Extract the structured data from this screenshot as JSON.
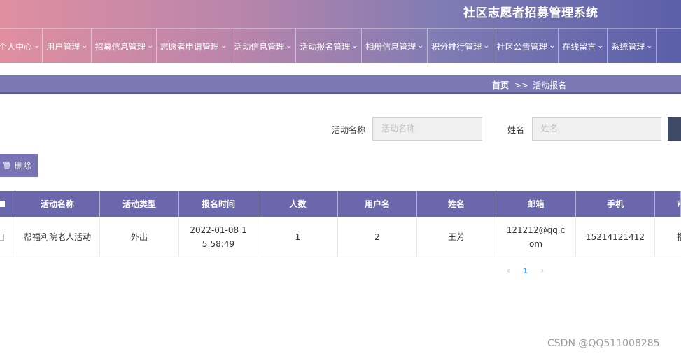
{
  "header": {
    "system_title": "社区志愿者招募管理系统",
    "nav": [
      {
        "label": "个人中心"
      },
      {
        "label": "用户管理"
      },
      {
        "label": "招募信息管理"
      },
      {
        "label": "志愿者申请管理"
      },
      {
        "label": "活动信息管理"
      },
      {
        "label": "活动报名管理"
      },
      {
        "label": "相册信息管理"
      },
      {
        "label": "积分排行管理"
      },
      {
        "label": "社区公告管理"
      },
      {
        "label": "在线留言"
      },
      {
        "label": "系统管理"
      }
    ]
  },
  "breadcrumb": {
    "home": "首页",
    "separator": ">>",
    "current": "活动报名"
  },
  "search": {
    "activity_label": "活动名称",
    "activity_placeholder": "活动名称",
    "name_label": "姓名",
    "name_placeholder": "姓名"
  },
  "toolbar": {
    "delete_label": "删除"
  },
  "table": {
    "columns": [
      "活动名称",
      "活动类型",
      "报名时间",
      "人数",
      "用户名",
      "姓名",
      "邮箱",
      "手机",
      "审"
    ],
    "rows": [
      {
        "activity_name": "帮福利院老人活动",
        "activity_type": "外出",
        "signup_time": "2022-01-08 15:58:49",
        "count": "1",
        "username": "2",
        "name": "王芳",
        "email": "121212@qq.com",
        "phone": "15214121412",
        "review": "指"
      }
    ]
  },
  "pagination": {
    "prev": "‹",
    "current_page": "1",
    "next": "›"
  },
  "watermark": "CSDN @QQ511008285",
  "colors": {
    "header_start": "#e08fa0",
    "header_end": "#5b5fa8",
    "table_header": "#6b67ad",
    "delete_button": "#7873b4"
  }
}
